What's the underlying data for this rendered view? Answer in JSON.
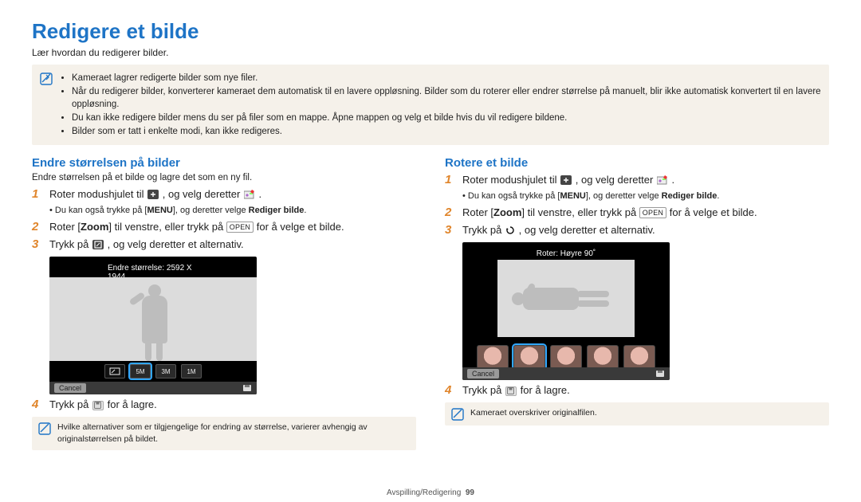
{
  "page": {
    "title": "Redigere et bilde",
    "subtitle": "Lær hvordan du redigerer bilder.",
    "footer_section": "Avspilling/Redigering",
    "footer_page": "99"
  },
  "topnote": {
    "items": [
      "Kameraet lagrer redigerte bilder som nye filer.",
      "Når du redigerer bilder, konverterer kameraet dem automatisk til en lavere oppløsning. Bilder som du roterer eller endrer størrelse på manuelt, blir ikke automatisk konvertert til en lavere oppløsning.",
      "Du kan ikke redigere bilder mens du ser på filer som en mappe. Åpne mappen og velg et bilde hvis du vil redigere bildene.",
      "Bilder som er tatt i enkelte modi, kan ikke redigeres."
    ]
  },
  "left": {
    "heading": "Endre størrelsen på bilder",
    "lead": "Endre størrelsen på et bilde og lagre det som en ny fil.",
    "steps": {
      "s1_a": "Roter modushjulet til ",
      "s1_b": ", og velg deretter ",
      "s1_c": ".",
      "s1_sub_a": "Du kan også trykke på [",
      "s1_sub_menu": "MENU",
      "s1_sub_b": "], og deretter velge ",
      "s1_sub_bold": "Rediger bilde",
      "s1_sub_c": ".",
      "s2_a": "Roter [",
      "s2_zoom": "Zoom",
      "s2_b": "] til venstre, eller trykk på ",
      "s2_key": "OPEN",
      "s2_c": " for å velge et bilde.",
      "s3_a": "Trykk på ",
      "s3_b": ", og velg deretter et alternativ.",
      "s4_a": "Trykk på ",
      "s4_b": " for å lagre."
    },
    "screen_label": "Endre størrelse: 2592 X 1944",
    "screen_cancel": "Cancel",
    "thumbs": [
      "",
      "5M",
      "3M",
      "1M"
    ],
    "selected_thumb_index": 1,
    "note": "Hvilke alternativer som er tilgjengelige for endring av størrelse, varierer avhengig av originalstørrelsen på bildet."
  },
  "right": {
    "heading": "Rotere et bilde",
    "steps": {
      "s1_a": "Roter modushjulet til ",
      "s1_b": ", og velg deretter ",
      "s1_c": ".",
      "s1_sub_a": "Du kan også trykke på [",
      "s1_sub_menu": "MENU",
      "s1_sub_b": "], og deretter velge ",
      "s1_sub_bold": "Rediger bilde",
      "s1_sub_c": ".",
      "s2_a": "Roter [",
      "s2_zoom": "Zoom",
      "s2_b": "] til venstre, eller trykk på ",
      "s2_key": "OPEN",
      "s2_c": " for å velge et bilde.",
      "s3_a": "Trykk på ",
      "s3_b": ", og velg deretter et alternativ.",
      "s4_a": "Trykk på ",
      "s4_b": " for å lagre."
    },
    "screen_label": "Roter: Høyre 90˚",
    "screen_cancel": "Cancel",
    "selected_thumb_index": 1,
    "thumb_count": 5,
    "note": "Kameraet overskriver originalfilen."
  },
  "icons": {
    "note": "note-icon",
    "mode_dial": "mode-dial-plus-icon",
    "edit_picture": "edit-picture-icon",
    "resize": "resize-icon",
    "rotate": "rotate-icon",
    "save": "save-icon"
  },
  "colors": {
    "accent": "#1E74C6",
    "step_number": "#E0852B",
    "notes_bg": "#F5F1EA"
  }
}
